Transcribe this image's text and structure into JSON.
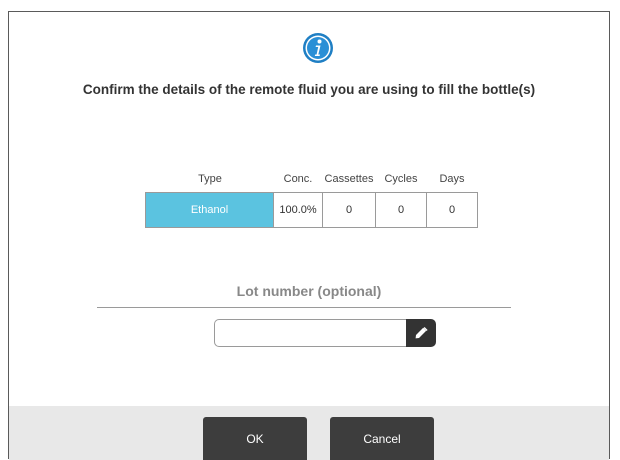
{
  "dialog": {
    "icon": "info-icon",
    "heading": "Confirm the details of the remote fluid you are using to fill the bottle(s)"
  },
  "table": {
    "headers": {
      "type": "Type",
      "conc": "Conc.",
      "cassettes": "Cassettes",
      "cycles": "Cycles",
      "days": "Days"
    },
    "row": {
      "type": "Ethanol",
      "conc": "100.0%",
      "cassettes": "0",
      "cycles": "0",
      "days": "0"
    },
    "type_color": "#5bc3e0"
  },
  "lot": {
    "label": "Lot number (optional)",
    "value": "",
    "edit_icon": "pencil-icon"
  },
  "buttons": {
    "ok": "OK",
    "cancel": "Cancel"
  }
}
